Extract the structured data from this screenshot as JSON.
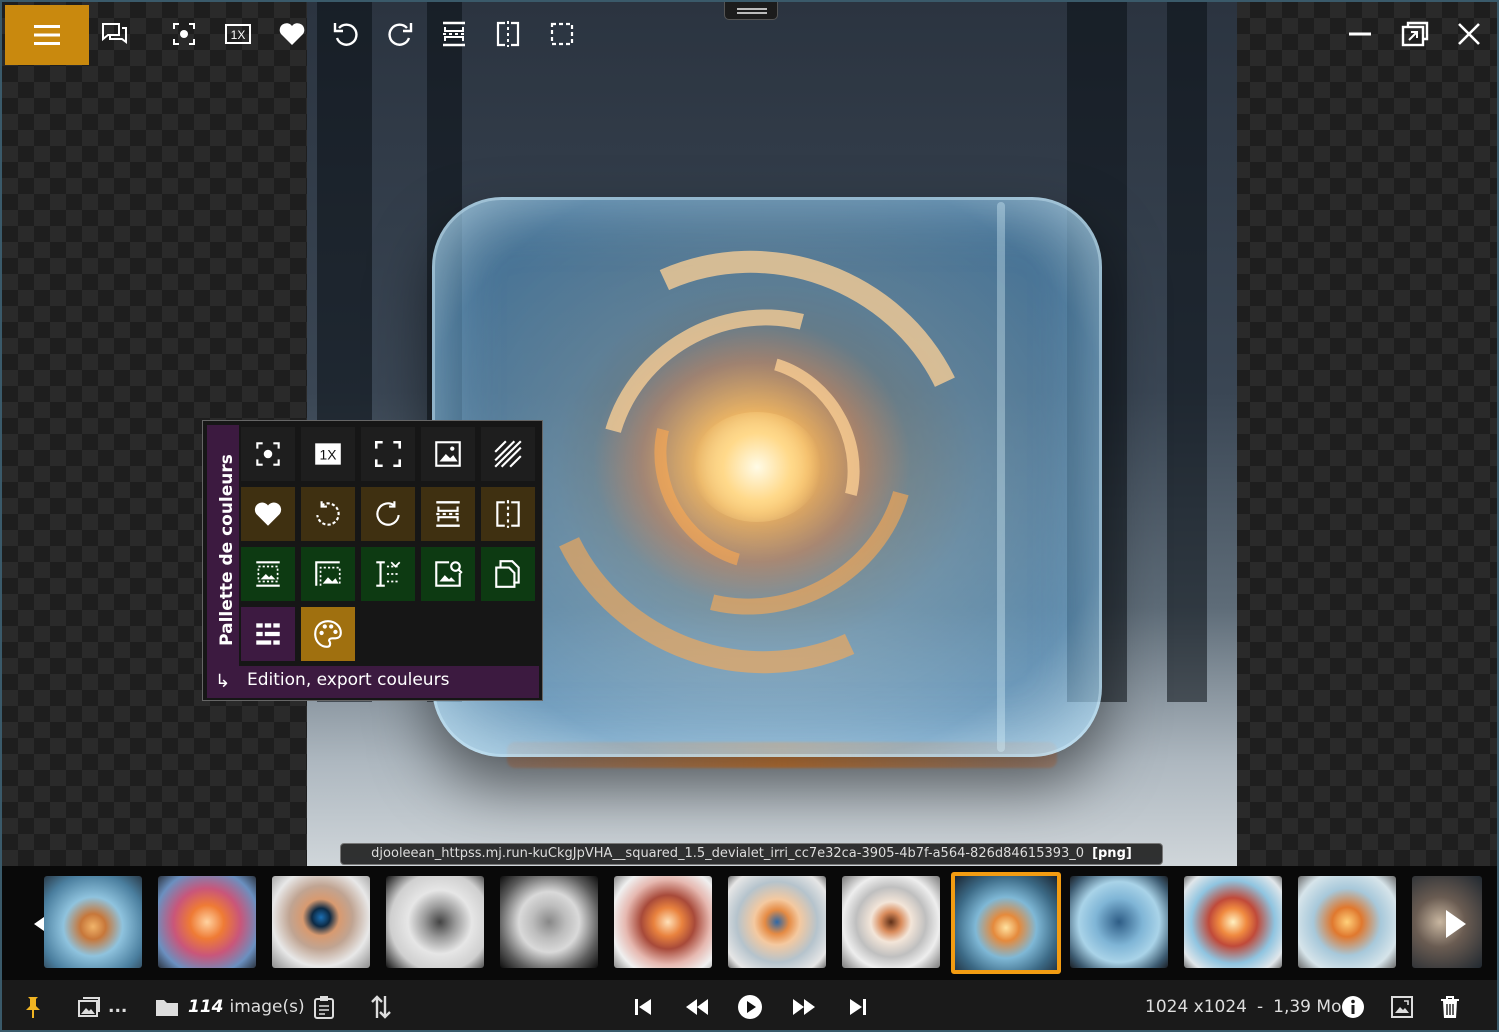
{
  "popup": {
    "title": "Pallette de couleurs",
    "caption": "Edition, export couleurs",
    "zoom_badge": "1X"
  },
  "toolbar": {
    "zoom_badge": "1X"
  },
  "filename": {
    "name": "djooleean_httpss.mj.run-kuCkgJpVHA__squared_1.5_devialet_irri_cc7e32ca-3905-4b7f-a564-826d84615393_0",
    "ext": "[png]"
  },
  "status": {
    "folder_ellipsis": "...",
    "image_count": "114",
    "image_unit": "image(s)",
    "dimensions": "1024 x1024",
    "separator": "-",
    "filesize": "1,39 Mo"
  },
  "thumbnails": {
    "selected_index": 8,
    "count": 12
  },
  "colors": {
    "accent": "#c9890e",
    "selection": "#f39c12",
    "palette_purple": "#3c1a40",
    "palette_green": "#0d3a12",
    "palette_brown": "#3f3011"
  },
  "icons": {
    "top_toolbar": [
      "menu-icon",
      "chat-icon",
      "focus-icon",
      "zoom-1x-icon",
      "heart-icon",
      "rotate-left-icon",
      "rotate-right-icon",
      "flip-vertical-icon",
      "flip-horizontal-icon",
      "crop-frame-icon",
      "minimize-icon",
      "restore-icon",
      "close-icon"
    ],
    "status_bar": [
      "pin-icon",
      "gallery-icon",
      "folder-icon",
      "clipboard-icon",
      "sort-icon",
      "skip-first-icon",
      "rewind-icon",
      "play-icon",
      "fast-forward-icon",
      "skip-last-icon",
      "info-icon",
      "fit-image-icon",
      "trash-icon"
    ]
  }
}
